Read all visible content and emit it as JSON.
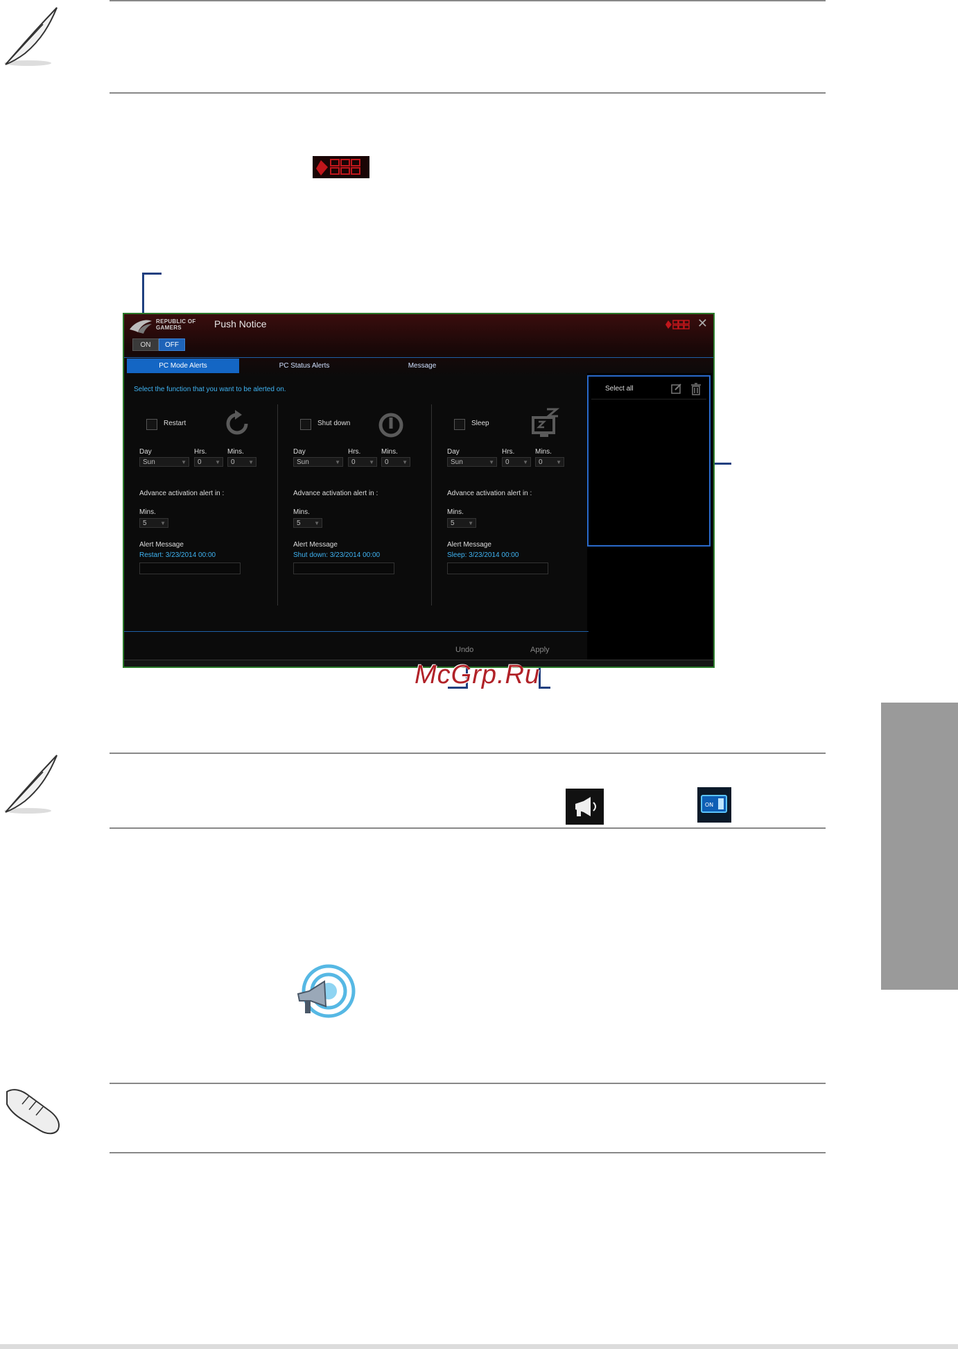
{
  "app": {
    "brand_line1": "REPUBLIC OF",
    "brand_line2": "GAMERS",
    "title": "Push Notice",
    "close": "✕",
    "switch": {
      "on": "ON",
      "off": "OFF"
    },
    "tabs": [
      {
        "label": "PC Mode Alerts",
        "active": true
      },
      {
        "label": "PC Status Alerts",
        "active": false
      },
      {
        "label": "Message",
        "active": false
      }
    ],
    "hint": "Select the function that you want to be alerted on.",
    "columns": [
      {
        "name": "Restart",
        "day_label": "Day",
        "hrs_label": "Hrs.",
        "mins_label": "Mins.",
        "day": "Sun",
        "hrs": "0",
        "mins": "0",
        "advance_label": "Advance activation alert in :",
        "adv_mins_label": "Mins.",
        "adv_mins": "5",
        "alert_label": "Alert Message",
        "alert_text": "Restart: 3/23/2014 00:00"
      },
      {
        "name": "Shut down",
        "day_label": "Day",
        "hrs_label": "Hrs.",
        "mins_label": "Mins.",
        "day": "Sun",
        "hrs": "0",
        "mins": "0",
        "advance_label": "Advance activation alert in :",
        "adv_mins_label": "Mins.",
        "adv_mins": "5",
        "alert_label": "Alert Message",
        "alert_text": "Shut down: 3/23/2014 00:00"
      },
      {
        "name": "Sleep",
        "day_label": "Day",
        "hrs_label": "Hrs.",
        "mins_label": "Mins.",
        "day": "Sun",
        "hrs": "0",
        "mins": "0",
        "advance_label": "Advance activation alert in :",
        "adv_mins_label": "Mins.",
        "adv_mins": "5",
        "alert_label": "Alert Message",
        "alert_text": "Sleep: 3/23/2014 00:00"
      }
    ],
    "select_all": "Select all",
    "undo": "Undo",
    "apply": "Apply"
  },
  "small_on_label": "ON",
  "watermark": "McGrp.Ru",
  "colors": {
    "accent_blue": "#1466c4",
    "cyan_text": "#3fb3f2",
    "callout": "#1f3f7f",
    "rog_red": "#c0161b"
  }
}
